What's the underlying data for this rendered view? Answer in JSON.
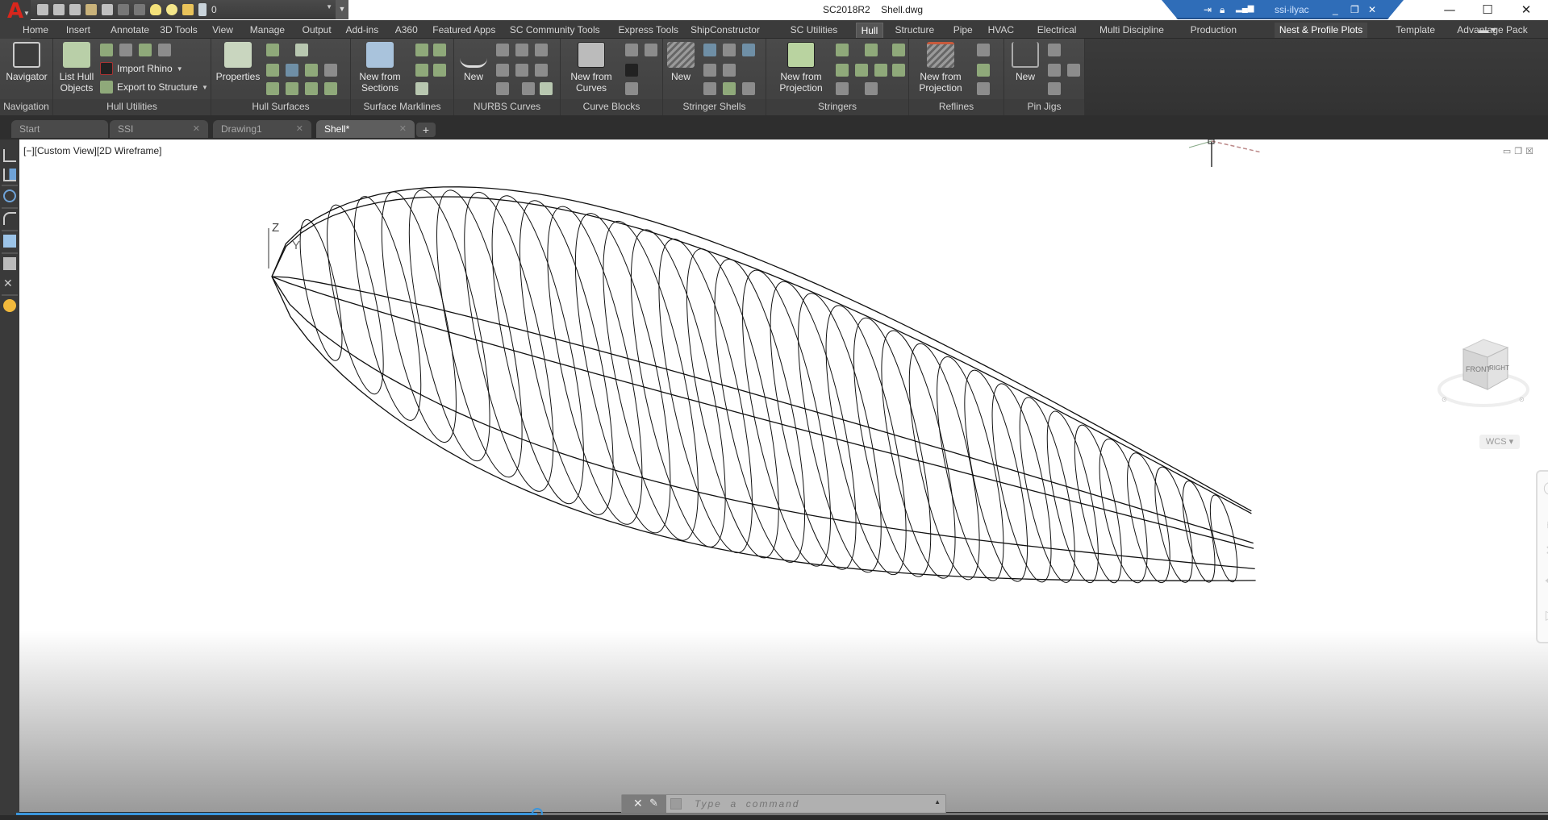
{
  "titlebar": {
    "version": "SC2018R2",
    "file": "Shell.dwg",
    "remote_session": {
      "user": "ssi-ilyac",
      "icons": [
        "pin-icon",
        "lock-icon",
        "signal-icon"
      ],
      "controls": [
        "minimize",
        "restore",
        "close"
      ]
    },
    "window_controls": {
      "minimize": "—",
      "maximize": "☐",
      "close": "✕"
    }
  },
  "app_button": {
    "letter": "A"
  },
  "quick_access": {
    "icons": [
      "new-icon",
      "open-icon",
      "save-icon",
      "save-as-icon",
      "plot-icon",
      "undo-icon",
      "redo-icon",
      "layer-bulb-icon",
      "layer-sun-icon",
      "layer-lock-icon",
      "layer-color-icon"
    ],
    "layer_value": "0"
  },
  "ribbon_tabs": [
    {
      "label": "Home"
    },
    {
      "label": "Insert"
    },
    {
      "label": "Annotate"
    },
    {
      "label": "3D Tools"
    },
    {
      "label": "View"
    },
    {
      "label": "Manage"
    },
    {
      "label": "Output"
    },
    {
      "label": "Add-ins"
    },
    {
      "label": "A360"
    },
    {
      "label": "Featured Apps"
    },
    {
      "label": "SC Community Tools"
    },
    {
      "label": "Express Tools"
    },
    {
      "label": "ShipConstructor"
    },
    {
      "label": "SC Utilities"
    },
    {
      "label": "Hull",
      "active": true
    },
    {
      "label": "Structure"
    },
    {
      "label": "Pipe"
    },
    {
      "label": "HVAC"
    },
    {
      "label": "Electrical"
    },
    {
      "label": "Multi Discipline"
    },
    {
      "label": "Production"
    },
    {
      "label": "Nest & Profile Plots",
      "hover": true
    },
    {
      "label": "Template"
    },
    {
      "label": "Advantage Pack"
    }
  ],
  "ribbon_panels": {
    "navigation": {
      "label": "Navigation",
      "big": "Navigator"
    },
    "hull_utilities": {
      "label": "Hull Utilities",
      "big": "List Hull\nObjects",
      "big_l1": "List Hull",
      "big_l2": "Objects",
      "import_rhino": "Import Rhino",
      "export_structure": "Export to Structure"
    },
    "hull_surfaces": {
      "label": "Hull Surfaces",
      "big": "Properties"
    },
    "surface_marklines": {
      "label": "Surface Marklines",
      "big_l1": "New from",
      "big_l2": "Sections"
    },
    "nurbs_curves": {
      "label": "NURBS Curves",
      "big": "New"
    },
    "curve_blocks": {
      "label": "Curve Blocks",
      "big_l1": "New from",
      "big_l2": "Curves"
    },
    "stringer_shells": {
      "label": "Stringer Shells",
      "big": "New"
    },
    "stringers": {
      "label": "Stringers",
      "big_l1": "New from",
      "big_l2": "Projection"
    },
    "reflines": {
      "label": "Reflines",
      "big_l1": "New from",
      "big_l2": "Projection"
    },
    "pin_jigs": {
      "label": "Pin Jigs",
      "big": "New"
    }
  },
  "file_tabs": [
    {
      "label": "Start",
      "closable": false
    },
    {
      "label": "SSI",
      "closable": true
    },
    {
      "label": "Drawing1",
      "closable": true
    },
    {
      "label": "Shell*",
      "closable": true,
      "active": true
    }
  ],
  "new_tab_label": "+",
  "viewport": {
    "label": "[−][Custom View][2D Wireframe]",
    "ucs": {
      "z": "Z",
      "y": "Y"
    },
    "viewcube": {
      "front": "FRONT",
      "right": "RIGHT"
    },
    "wcs_label": "WCS ▾",
    "navbar_tools": [
      "steering-wheel-icon",
      "pan-icon",
      "zoom-extents-icon",
      "orbit-icon",
      "showmotion-icon"
    ],
    "hull": {
      "sections": 34,
      "longitudinals": 6
    }
  },
  "command_line": {
    "placeholder": "Type  a  command",
    "close": "✕",
    "customize": "🔧",
    "prompt": ">_"
  },
  "video_progress": {
    "fraction": 0.34
  }
}
